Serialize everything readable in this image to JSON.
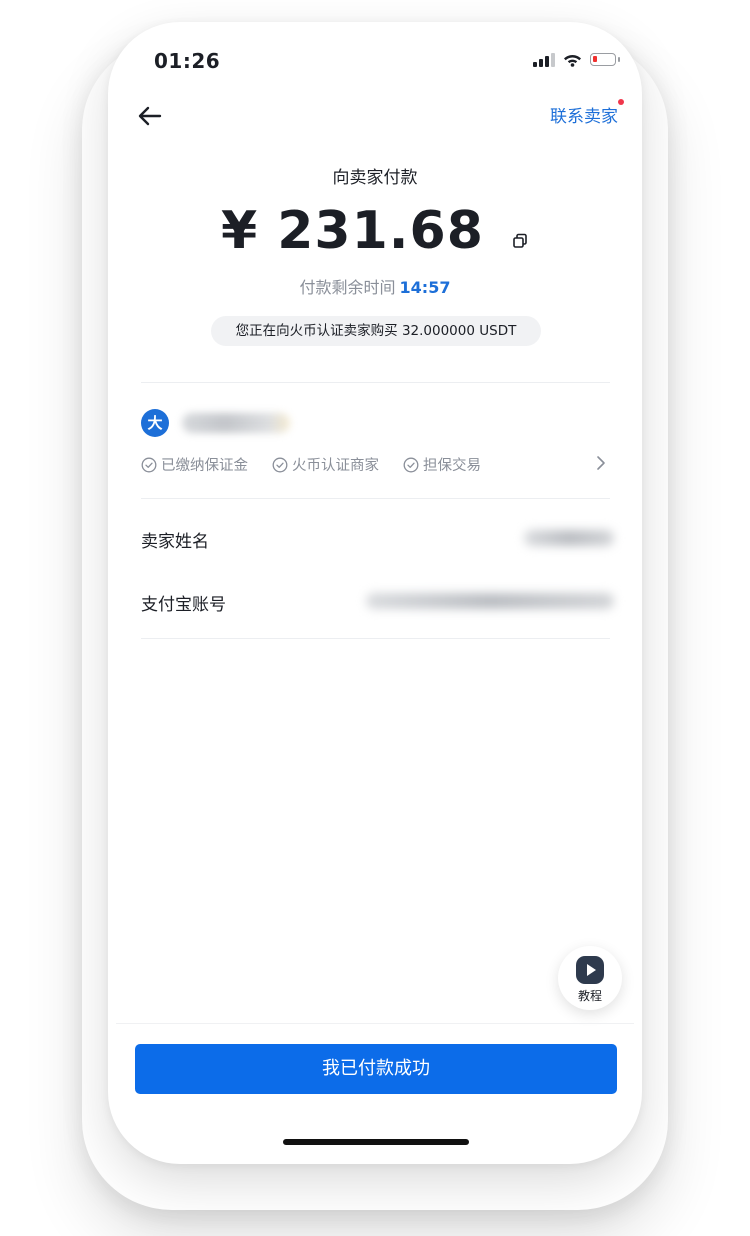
{
  "status_bar": {
    "time": "01:26"
  },
  "nav": {
    "contact_label": "联系卖家"
  },
  "payment": {
    "title": "向卖家付款",
    "amount": "¥ 231.68",
    "countdown_label": "付款剩余时间",
    "countdown_value": "14:57",
    "purchase_notice": "您正在向火币认证卖家购买 32.000000 USDT"
  },
  "merchant": {
    "avatar_letter": "大",
    "badges": [
      {
        "label": "已缴纳保证金"
      },
      {
        "label": "火币认证商家"
      },
      {
        "label": "担保交易"
      }
    ]
  },
  "info_rows": {
    "seller_name_label": "卖家姓名",
    "alipay_account_label": "支付宝账号"
  },
  "tutorial": {
    "label": "教程"
  },
  "actions": {
    "confirm_paid_label": "我已付款成功"
  },
  "colors": {
    "accent": "#0c6ce9",
    "link": "#1d6fd8",
    "notify_dot": "#f0364b"
  },
  "icons": [
    "back-arrow-icon",
    "copy-icon",
    "check-circle-icon",
    "chevron-right-icon",
    "play-icon",
    "wifi-icon",
    "signal-icon",
    "battery-icon"
  ]
}
